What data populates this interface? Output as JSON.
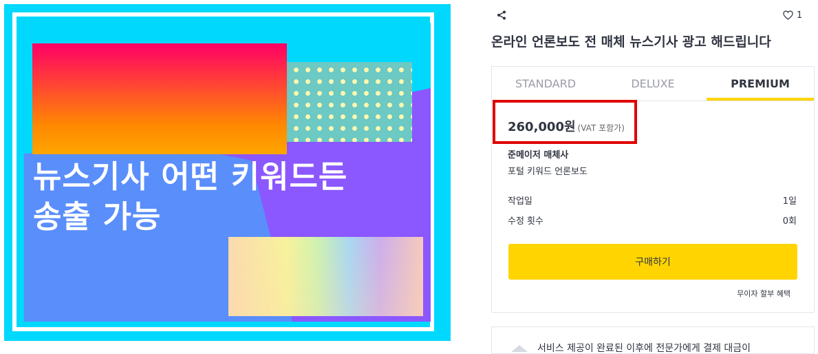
{
  "banner": {
    "headline_line1": "뉴스기사 어떤 키워드든",
    "headline_line2": "송출 가능",
    "colors": {
      "cyan": "#01d8fd",
      "blue": "#5a8efb",
      "purple": "#8b57ff",
      "dots_bg": "#6cc9c4",
      "dots": "#fff7b0"
    }
  },
  "header": {
    "share_icon": "share-icon",
    "like_icon": "heart-outline-icon",
    "like_count": "1"
  },
  "product": {
    "title": "온라인 언론보도 전 매체 뉴스기사 광고 해드립니다"
  },
  "package": {
    "tabs": [
      {
        "label": "STANDARD",
        "active": false
      },
      {
        "label": "DELUXE",
        "active": false
      },
      {
        "label": "PREMIUM",
        "active": true
      }
    ],
    "price": "260,000원",
    "vat_note": "(VAT 포함가)",
    "name": "준메이저 매체사",
    "description": "포털 키워드 언론보도",
    "rows": [
      {
        "label": "작업일",
        "value": "1일"
      },
      {
        "label": "수정 횟수",
        "value": "0회"
      }
    ],
    "buy_label": "구매하기",
    "installment_label": "무이자 할부 혜택",
    "accent_color": "#ffd400",
    "highlight_color": "#e00000"
  },
  "notice": {
    "text": "서비스 제공이 완료된 이후에 전문가에게 결제 대금이"
  }
}
